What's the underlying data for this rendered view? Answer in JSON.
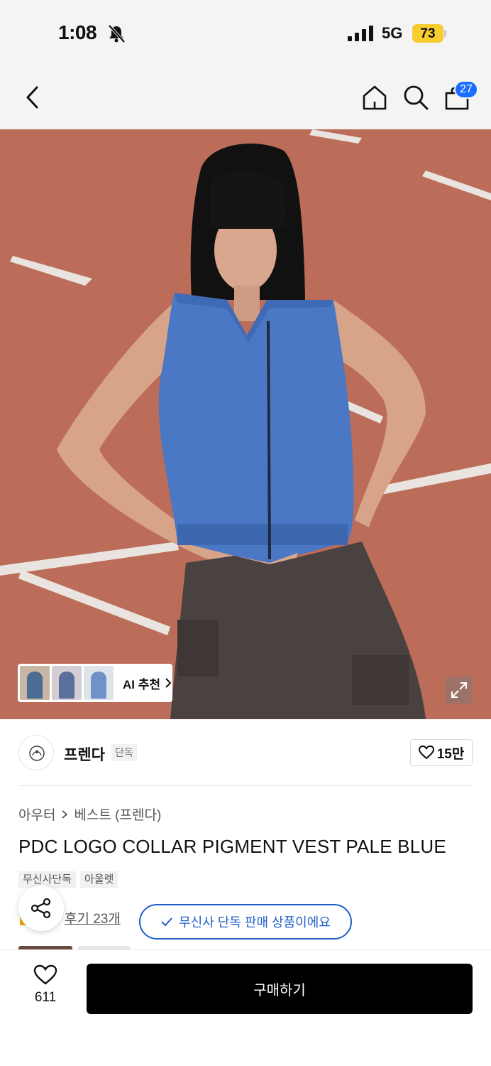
{
  "status_bar": {
    "time": "1:08",
    "network": "5G",
    "battery": "73",
    "battery_color": "#f6cc2e"
  },
  "nav": {
    "cart_count": "27",
    "badge_color": "#1a6dff"
  },
  "hero": {
    "ai_label": "AI 추천"
  },
  "brand": {
    "name": "프렌다",
    "tag": "단독",
    "likes": "15만"
  },
  "product": {
    "breadcrumb": [
      "아우터",
      "베스트 (프렌다)"
    ],
    "title": "PDC LOGO COLLAR PIGMENT VEST PALE BLUE",
    "tags": [
      "무신사단독",
      "아울렛"
    ],
    "review_link": "후기 23개",
    "exclusive_badge": "무신사 단독 판매 상품이에요",
    "accent_color": "#1d5ec9"
  },
  "bottom_bar": {
    "wish_count": "611",
    "buy_label": "구매하기"
  }
}
